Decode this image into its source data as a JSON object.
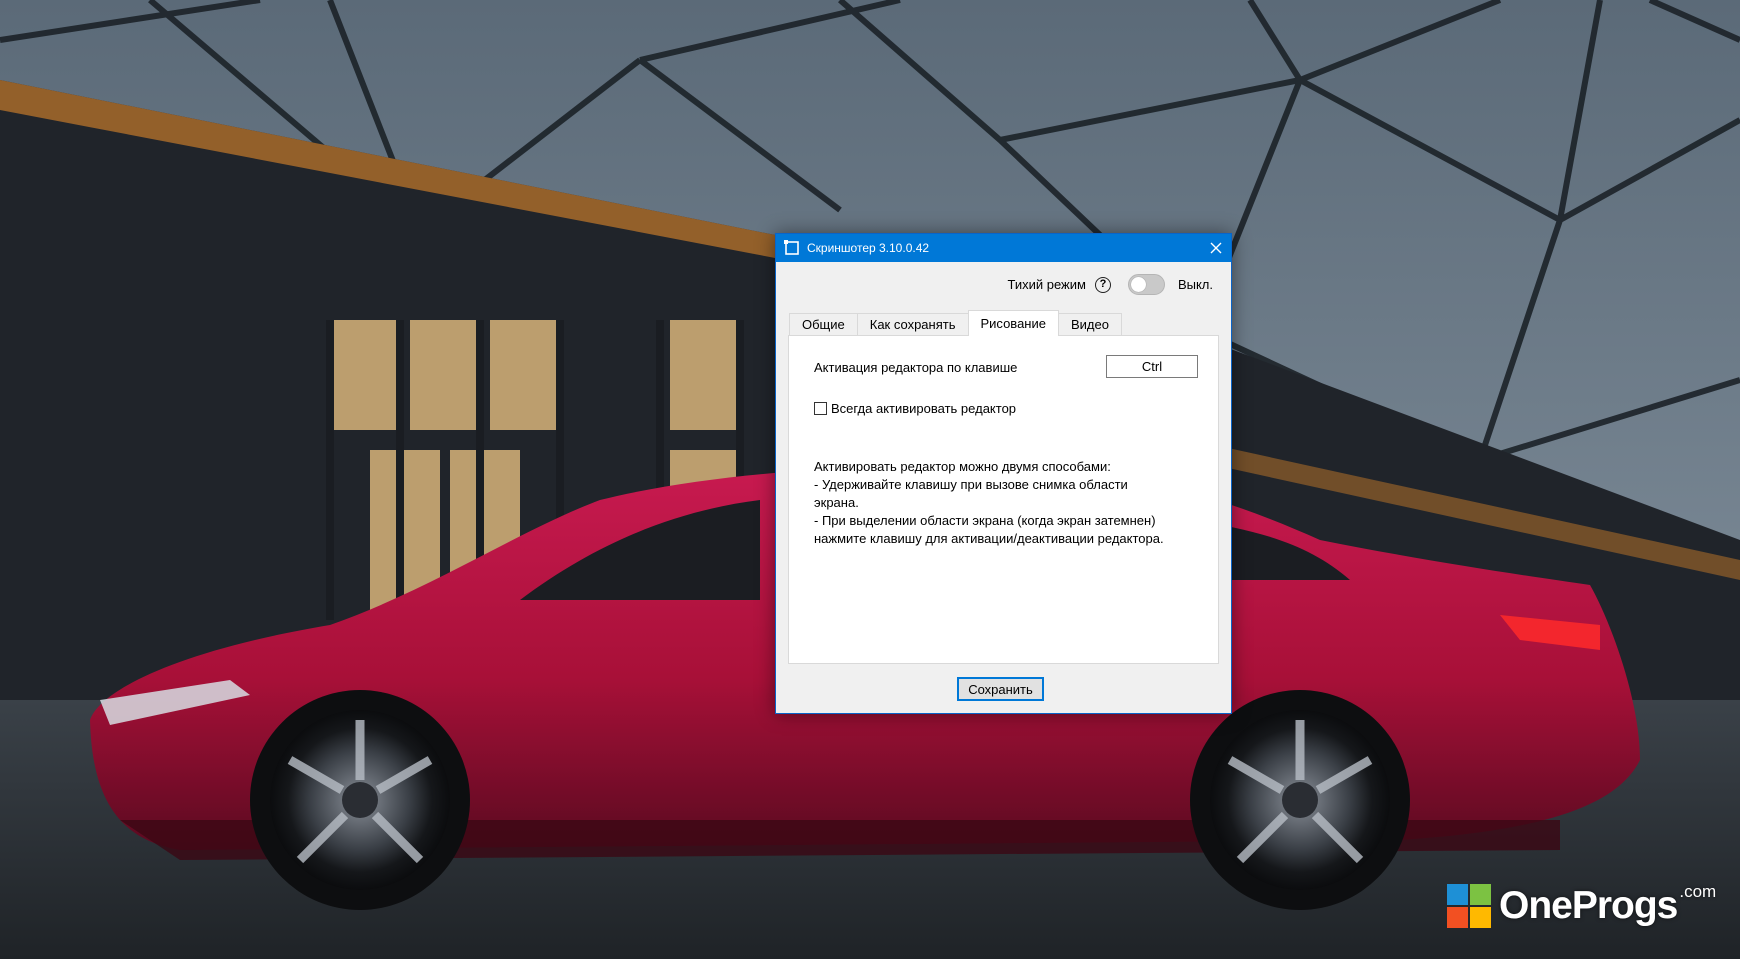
{
  "window": {
    "title": "Скриншотер 3.10.0.42",
    "title_icon": "screenshot-frame-icon",
    "close_icon": "close-icon"
  },
  "quiet_mode": {
    "label": "Тихий режим",
    "help_glyph": "?",
    "state_label": "Выкл.",
    "enabled": false
  },
  "tabs": [
    {
      "label": "Общие",
      "active": false
    },
    {
      "label": "Как сохранять",
      "active": false
    },
    {
      "label": "Рисование",
      "active": true
    },
    {
      "label": "Видео",
      "active": false
    }
  ],
  "drawing": {
    "hotkey_label": "Активация редактора по клавише",
    "hotkey_value": "Ctrl",
    "always_activate_label": "Всегда активировать редактор",
    "always_activate_checked": false,
    "info_lines": [
      "Активировать редактор можно двумя способами:",
      "- Удерживайте клавишу при вызове снимка области",
      "экрана.",
      "- При выделении области экрана (когда экран затемнен)",
      "нажмите клавишу для активации/деактивации редактора."
    ]
  },
  "save_button": "Сохранить",
  "watermark": {
    "text": "OneProgs",
    "suffix": ".com",
    "logo_colors": [
      "#1e90d6",
      "#7cc242",
      "#f25022",
      "#ffb900"
    ]
  },
  "colors": {
    "titlebar": "#0078d7",
    "dialog_bg": "#f0f0f0",
    "car": "#b0123e"
  }
}
